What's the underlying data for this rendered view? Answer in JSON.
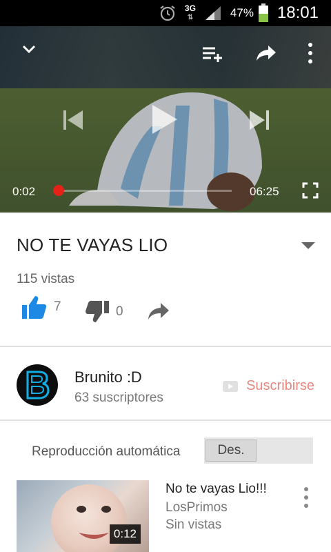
{
  "status_bar": {
    "network": "3G",
    "battery": "47%",
    "time": "18:01"
  },
  "player": {
    "current_time": "0:02",
    "duration": "06:25",
    "progress": 0.005
  },
  "video": {
    "title": "NO TE VAYAS LIO",
    "views": "115 vistas",
    "likes": "7",
    "dislikes": "0"
  },
  "channel": {
    "name": "Brunito :D",
    "subscribers": "63 suscriptores",
    "subscribe_label": "Suscribirse"
  },
  "autoplay": {
    "label": "Reproducción automática",
    "state": "Des."
  },
  "related": [
    {
      "title": "No te vayas Lio!!!",
      "channel": "LosPrimos",
      "views": "Sin vistas",
      "duration": "0:12"
    }
  ],
  "colors": {
    "accent": "#e62117",
    "like": "#1e88e5",
    "subscribe": "#e8867f"
  }
}
